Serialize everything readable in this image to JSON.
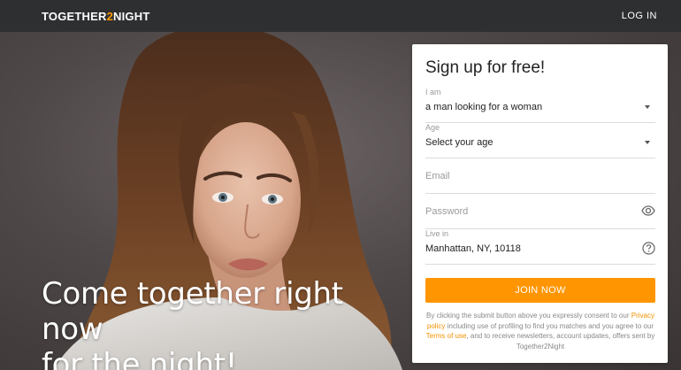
{
  "header": {
    "logo_prefix": "TOGETHER",
    "logo_number": "2",
    "logo_suffix": "NIGHT",
    "login_label": "LOG IN"
  },
  "hero": {
    "headline_line1": "Come together right now",
    "headline_line2": "for the night!"
  },
  "signup": {
    "title": "Sign up for free!",
    "i_am_label": "I am",
    "i_am_value": "a man looking for a woman",
    "age_label": "Age",
    "age_value": "Select your age",
    "email_placeholder": "Email",
    "password_placeholder": "Password",
    "live_in_label": "Live in",
    "live_in_value": "Manhattan, NY, 10118",
    "join_label": "JOIN NOW",
    "consent_1": "By clicking the submit button above you expressly consent to our",
    "privacy_link": "Privacy policy",
    "consent_2": "including use of profiling to find you matches and you agree to our",
    "terms_link": "Terms of use",
    "consent_3": ", and to receive newsletters, account updates, offers sent by Together2Night"
  },
  "icons": {
    "password_toggle": "eye-icon",
    "location_help": "question-circle-icon",
    "dropdown": "chevron-down-icon"
  },
  "colors": {
    "accent": "#ff9500",
    "topbar": "#2e2f31",
    "link": "#f39200"
  }
}
